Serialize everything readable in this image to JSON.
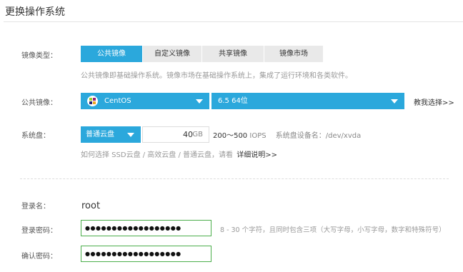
{
  "page": {
    "title": "更换操作系统"
  },
  "image_type": {
    "label": "镜像类型：",
    "tabs": [
      {
        "label": "公共镜像",
        "active": true
      },
      {
        "label": "自定义镜像",
        "active": false
      },
      {
        "label": "共享镜像",
        "active": false
      },
      {
        "label": "镜像市场",
        "active": false
      }
    ],
    "hint": "公共镜像即基础操作系统。镜像市场在基础操作系统上，集成了运行环境和各类软件。"
  },
  "public_image": {
    "label": "公共镜像：",
    "os": "CentOS",
    "version": "6.5 64位",
    "help_link": "教我选择>>"
  },
  "system_disk": {
    "label": "系统盘：",
    "type": "普通云盘",
    "size": "40",
    "unit": "GB",
    "iops_range": "200～500",
    "iops_unit": "IOPS",
    "device_label": "系统盘设备名：/dev/xvda",
    "hint_prefix": "如何选择 SSD云盘 / 高效云盘 / 普通云盘，请看",
    "hint_link": "详细说明>>"
  },
  "login": {
    "name_label": "登录名：",
    "name_value": "root",
    "password_label": "登录密码：",
    "password_value": "●●●●●●●●●●●●●●●●●●",
    "password_hint": "8 - 30 个字符，且同时包含三项（大写字母，小写字母，数字和特殊符号）",
    "confirm_label": "确认密码：",
    "confirm_value": "●●●●●●●●●●●●●●●●●●"
  },
  "colors": {
    "accent": "#2ba8dc",
    "valid_border": "#4cae4c"
  }
}
